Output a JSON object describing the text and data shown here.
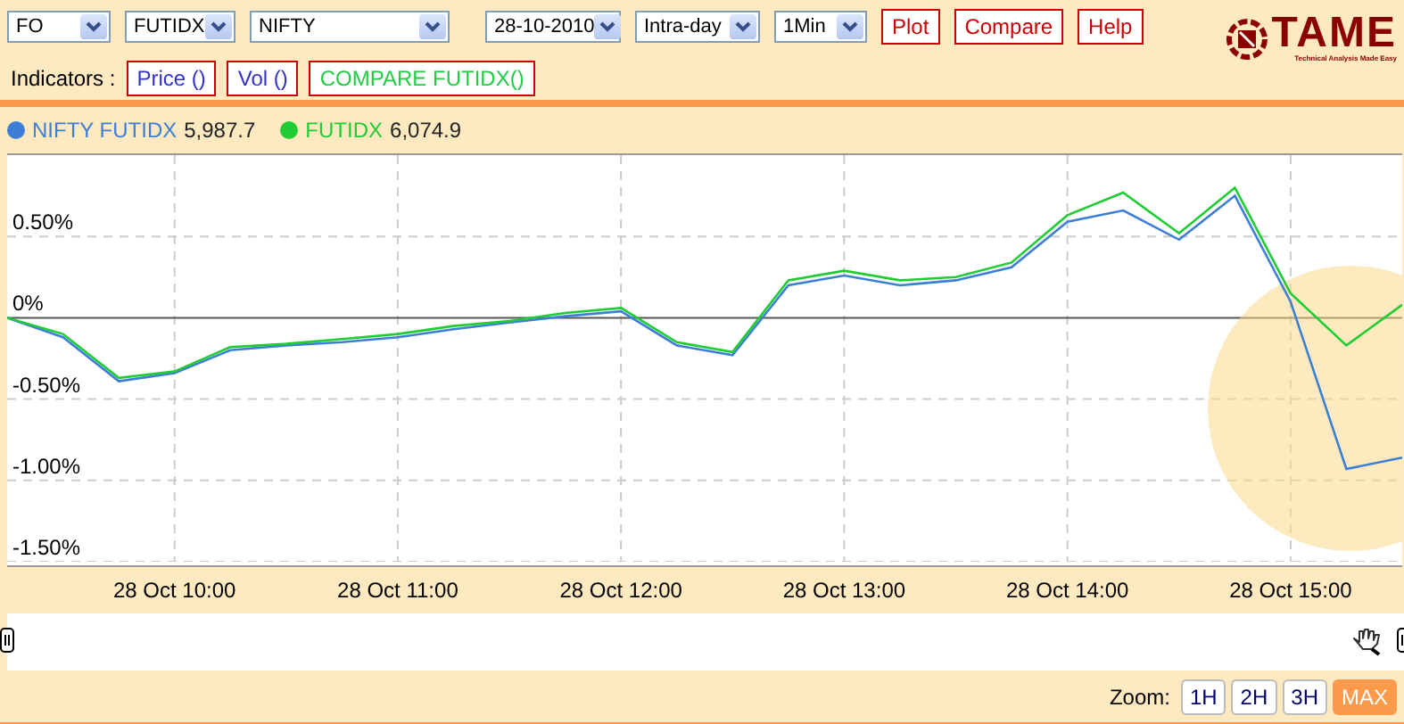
{
  "toolbar": {
    "selects": [
      {
        "value": "FO"
      },
      {
        "value": "FUTIDX"
      },
      {
        "value": "NIFTY"
      },
      {
        "value": "28-10-2010"
      },
      {
        "value": "Intra-day"
      },
      {
        "value": "1Min"
      }
    ],
    "buttons": [
      "Plot",
      "Compare",
      "Help"
    ],
    "logo": {
      "text": "TAME",
      "tagline": "Technical Analysis Made Easy"
    }
  },
  "indicators": {
    "label": "Indicators :",
    "items": [
      {
        "label": "Price ()",
        "color": "#3333cc"
      },
      {
        "label": "Vol ()",
        "color": "#3333cc"
      },
      {
        "label": "COMPARE FUTIDX()",
        "color": "#22cc44"
      }
    ]
  },
  "legend": [
    {
      "value": "5,987.7"
    },
    {
      "value": "6,074.9"
    }
  ],
  "chart": {
    "chart_data": {
      "type": "line",
      "grid": true,
      "legend": "top",
      "categories": [
        null,
        null,
        null,
        "28 Oct 10:00",
        null,
        null,
        null,
        "28 Oct 11:00",
        null,
        null,
        null,
        "28 Oct 12:00",
        null,
        null,
        null,
        "28 Oct 13:00",
        null,
        null,
        null,
        "28 Oct 14:00",
        null,
        null,
        null,
        "28 Oct 15:00",
        null,
        null
      ],
      "series": [
        {
          "name": "NIFTY FUTIDX",
          "color": "#3d7fd6",
          "values": [
            0,
            -0.12,
            -0.39,
            -0.34,
            -0.2,
            -0.17,
            -0.15,
            -0.12,
            -0.07,
            -0.03,
            0.01,
            0.04,
            -0.17,
            -0.23,
            0.2,
            0.26,
            0.2,
            0.23,
            0.31,
            0.59,
            0.66,
            0.48,
            0.75,
            0.1,
            -0.93,
            -0.86
          ]
        },
        {
          "name": "FUTIDX",
          "color": "#1fcc33",
          "values": [
            0,
            -0.1,
            -0.37,
            -0.33,
            -0.18,
            -0.16,
            -0.13,
            -0.1,
            -0.05,
            -0.02,
            0.03,
            0.06,
            -0.15,
            -0.21,
            0.23,
            0.29,
            0.23,
            0.25,
            0.34,
            0.63,
            0.77,
            0.52,
            0.8,
            0.15,
            -0.17,
            0.08
          ]
        }
      ],
      "ylim": [
        -1.5,
        1.0
      ],
      "yticks": [
        {
          "value": 0.5,
          "label": "0.50%"
        },
        {
          "value": 0,
          "label": "0%"
        },
        {
          "value": -0.5,
          "label": "-0.50%"
        },
        {
          "value": -1,
          "label": "-1.00%"
        },
        {
          "value": -1.5,
          "label": "-1.50%"
        }
      ]
    }
  },
  "zoom": {
    "label": "Zoom:",
    "buttons": [
      {
        "label": "1H",
        "selected": false
      },
      {
        "label": "2H",
        "selected": false
      },
      {
        "label": "3H",
        "selected": false
      },
      {
        "label": "MAX",
        "selected": true
      }
    ]
  }
}
